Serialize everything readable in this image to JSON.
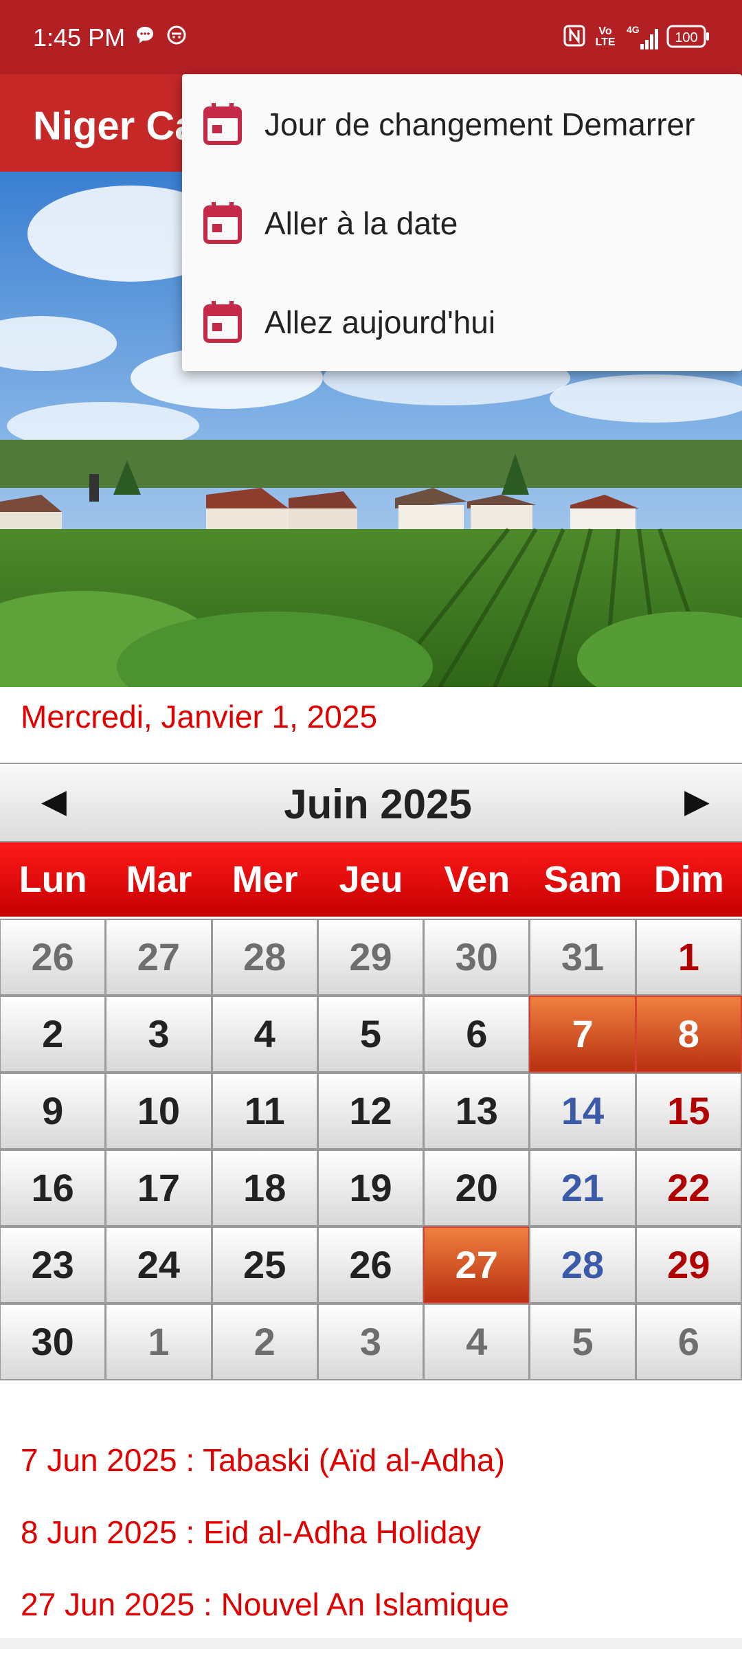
{
  "status_bar": {
    "time": "1:45 PM",
    "network": "4G",
    "volte": "Vo LTE",
    "battery": "100"
  },
  "app_bar": {
    "title": "Niger Calendar"
  },
  "selected_date": "Mercredi, Janvier 1, 2025",
  "calendar": {
    "month_label": "Juin  2025",
    "prev_arrow": "◀",
    "next_arrow": "▶",
    "weekdays": [
      "Lun",
      "Mar",
      "Mer",
      "Jeu",
      "Ven",
      "Sam",
      "Dim"
    ],
    "weeks": [
      [
        {
          "d": "26",
          "t": "muted"
        },
        {
          "d": "27",
          "t": "muted"
        },
        {
          "d": "28",
          "t": "muted"
        },
        {
          "d": "29",
          "t": "muted"
        },
        {
          "d": "30",
          "t": "muted"
        },
        {
          "d": "31",
          "t": "muted"
        },
        {
          "d": "1",
          "t": "sun"
        }
      ],
      [
        {
          "d": "2",
          "t": "cur"
        },
        {
          "d": "3",
          "t": "cur"
        },
        {
          "d": "4",
          "t": "cur"
        },
        {
          "d": "5",
          "t": "cur"
        },
        {
          "d": "6",
          "t": "cur"
        },
        {
          "d": "7",
          "t": "holiday"
        },
        {
          "d": "8",
          "t": "holiday"
        }
      ],
      [
        {
          "d": "9",
          "t": "cur"
        },
        {
          "d": "10",
          "t": "cur"
        },
        {
          "d": "11",
          "t": "cur"
        },
        {
          "d": "12",
          "t": "cur"
        },
        {
          "d": "13",
          "t": "cur"
        },
        {
          "d": "14",
          "t": "sat"
        },
        {
          "d": "15",
          "t": "sun"
        }
      ],
      [
        {
          "d": "16",
          "t": "cur"
        },
        {
          "d": "17",
          "t": "cur"
        },
        {
          "d": "18",
          "t": "cur"
        },
        {
          "d": "19",
          "t": "cur"
        },
        {
          "d": "20",
          "t": "cur"
        },
        {
          "d": "21",
          "t": "sat"
        },
        {
          "d": "22",
          "t": "sun"
        }
      ],
      [
        {
          "d": "23",
          "t": "cur"
        },
        {
          "d": "24",
          "t": "cur"
        },
        {
          "d": "25",
          "t": "cur"
        },
        {
          "d": "26",
          "t": "cur"
        },
        {
          "d": "27",
          "t": "holiday"
        },
        {
          "d": "28",
          "t": "sat"
        },
        {
          "d": "29",
          "t": "sun"
        }
      ],
      [
        {
          "d": "30",
          "t": "cur"
        },
        {
          "d": "1",
          "t": "muted"
        },
        {
          "d": "2",
          "t": "muted"
        },
        {
          "d": "3",
          "t": "muted"
        },
        {
          "d": "4",
          "t": "muted"
        },
        {
          "d": "5",
          "t": "muted"
        },
        {
          "d": "6",
          "t": "muted"
        }
      ]
    ]
  },
  "holidays": [
    "7 Jun 2025 : Tabaski (Aïd al-Adha)",
    "8 Jun 2025 : Eid al-Adha Holiday",
    "27 Jun 2025 : Nouvel An Islamique"
  ],
  "menu": {
    "items": [
      {
        "label": "Jour de changement Demarrer",
        "icon": "calendar-icon"
      },
      {
        "label": "Aller à la date",
        "icon": "calendar-icon"
      },
      {
        "label": "Allez aujourd'hui",
        "icon": "calendar-icon"
      }
    ]
  },
  "colors": {
    "status_bar": "#b22024",
    "app_bar": "#c62828",
    "accent_red": "#e00000",
    "holiday_orange": "#e0582a",
    "saturday_blue": "#3b5ba8"
  }
}
